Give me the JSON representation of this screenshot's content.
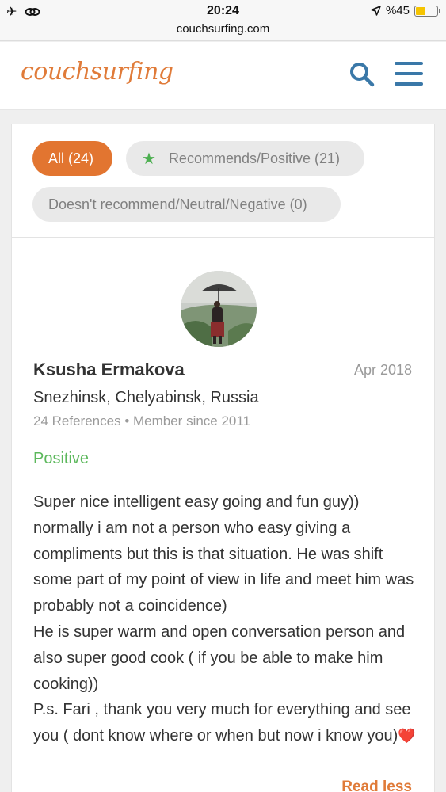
{
  "status_bar": {
    "time": "20:24",
    "url": "couchsurfing.com",
    "battery_text": "%45",
    "battery_level": 0.45,
    "left_icons": [
      "airplane-icon",
      "link-icon"
    ],
    "location_icon": "location-arrow-icon"
  },
  "header": {
    "logo": "couchsurfing",
    "search_icon": "search-icon",
    "menu_icon": "hamburger-menu-icon",
    "brand_color": "#e07b39",
    "icon_color": "#3a78a8"
  },
  "filters": {
    "all": "All (24)",
    "recommends": "Recommends/Positive (21)",
    "not_recommend": "Doesn't recommend/Neutral/Negative (0)",
    "active": "all",
    "active_color": "#e27530"
  },
  "review": {
    "name": "Ksusha Ermakova",
    "date": "Apr 2018",
    "location": "Snezhinsk, Chelyabinsk, Russia",
    "references": "24 References",
    "member_since": "Member since 2011",
    "type": "Positive",
    "paragraphs": [
      "Super nice intelligent easy going and fun guy)) normally i am not a person who easy giving a compliments but this is that situation. He was shift some part of my point of view in life and meet him was probably not a coincidence)",
      "He is super warm and open conversation person and also super good cook ( if you be able to make him cooking))",
      "P.s. Fari , thank you very much for everything and see you ( dont know where or when but now i know you)"
    ],
    "emoji": "❤️",
    "read_less": "Read less",
    "positive_color": "#5cb85c"
  }
}
